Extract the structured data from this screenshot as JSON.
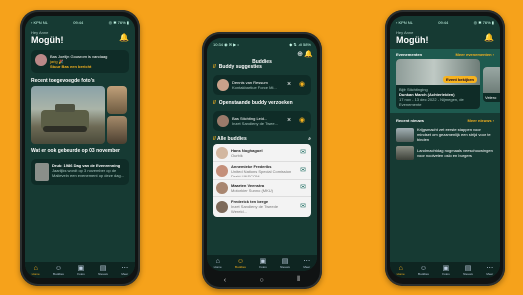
{
  "left": {
    "status_left": "‹ KPN NL ",
    "status_time": "09:44",
    "status_right": "◎ ✱ 76% ▮",
    "greeting": "Hey Anne",
    "title": "Mogüh!",
    "buddy_line": "Bas Joelijn Gousrom is vandaag",
    "buddy_date": "jarig 🎉",
    "buddy_link": "Stuur Bas een bericht",
    "section_photos": "Recent toegevoegde foto's",
    "section_history": "Wat er ook gebeurde op 03 november",
    "history_title": "Druk: 1986 Dag van de Evenrenning",
    "history_body": "Jaarlijks wordt op 3 november op de Malieveln een evenement op deze dag...",
    "nav": [
      "Home",
      "Buddies",
      "Fotos",
      "Nieuws",
      "Meer"
    ]
  },
  "middle": {
    "status_left": "10:34 ◉ ✉ ▶ •",
    "status_right": "◆ ⇅ .ıll 58%",
    "header": "Buddies",
    "suggestions_title": "Buddy suggesties",
    "suggestion_name": "Dennis van Ressum",
    "suggestion_sub": "Kontakbartiue Force Mi...",
    "sent_title": "Openstaande buddy verzoeken",
    "sent_name": "Bas Stichting Leid...",
    "sent_sub": "Inzet Sandieny de Twee...",
    "all_title": "Alle buddies",
    "buddies": [
      {
        "name": "Hans Noghagoel",
        "sub": "Ourbik"
      },
      {
        "name": "Annemieke Frederiks",
        "sub": "United Nations Special Comission Drakt UNSCOM"
      },
      {
        "name": "Maarten Veenstra",
        "sub": "Motorkier Sunno (MKU)"
      },
      {
        "name": "Frederick ten berge",
        "sub": "Inzet Sandieny de Tweede Wereld..."
      }
    ],
    "nav": [
      "Home",
      "Buddies",
      "Fotos",
      "Nieuws",
      "Meer"
    ]
  },
  "right": {
    "status_left": "‹ KPN NL ",
    "status_time": "09:44",
    "status_right": "◎ ✱ 76% ▮",
    "greeting": "Hey Anne",
    "title": "Mogüh!",
    "events_title": "Evenementen",
    "events_more": "Meer evenementen ›",
    "event_pill": "Event bekijken",
    "event_org": "Bijfr Stichtinging",
    "event_name": "Dunkan March (Achterleiden)",
    "event_date": "17 nov - 13 dec 2022 - Nijmegen, de Evenemente",
    "event2_name": "Velero",
    "news_title": "Recent nieuws",
    "news_more": "Meer nieuws ›",
    "news": [
      "Krijgsmacht zet eerste stappen voor mindset om gezamenlijk een strijd voor te binden",
      "Landmachtdag nogmaals veeschouwingen voor nooiveten oslo en burgers"
    ],
    "nav": [
      "Home",
      "Buddies",
      "Fotos",
      "Nieuws",
      "Meer"
    ]
  }
}
